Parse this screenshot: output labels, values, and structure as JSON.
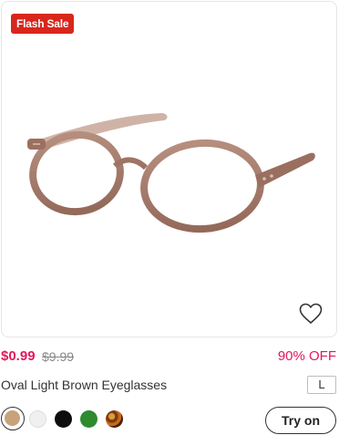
{
  "badge": {
    "label": "Flash Sale",
    "color": "#d9261c"
  },
  "product": {
    "name": "Oval Light Brown Eyeglasses",
    "price_current": "$0.99",
    "price_original": "$9.99",
    "discount": "90% OFF",
    "size": "L",
    "frame_color": "#a07868",
    "favorite_icon": "heart-outline-icon"
  },
  "colors": {
    "accent": "#e0195a",
    "swatches": [
      {
        "name": "light-brown",
        "hex": "#c8a27a",
        "selected": true
      },
      {
        "name": "clear",
        "hex": "#f0f0f0",
        "selected": false
      },
      {
        "name": "black",
        "hex": "#0d0d0d",
        "selected": false
      },
      {
        "name": "green",
        "hex": "#2e8b2e",
        "selected": false
      },
      {
        "name": "tortoise",
        "hex": "#7a3c12",
        "selected": false
      }
    ]
  },
  "actions": {
    "try_on_label": "Try on"
  }
}
